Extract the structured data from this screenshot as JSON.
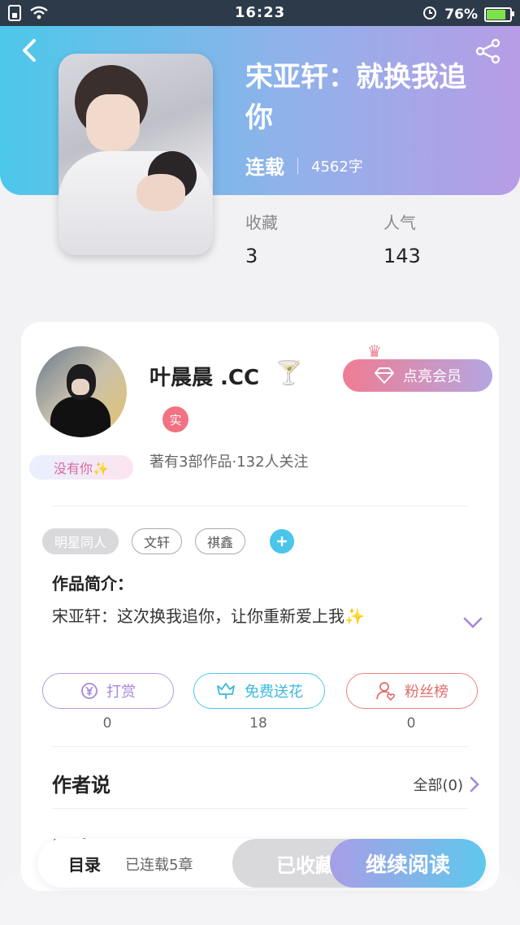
{
  "status_bar": {
    "time": "16:23",
    "battery": "76%",
    "battery_level": 0.76
  },
  "book": {
    "title": "宋亚轩：就换我追你",
    "status": "连载",
    "word_count": "4562字"
  },
  "stats": [
    {
      "label": "收藏",
      "value": "3"
    },
    {
      "label": "人气",
      "value": "143"
    }
  ],
  "author": {
    "name": "叶晨晨 .CC",
    "verify_badge": "实",
    "badge_frame_text": "没有你✨",
    "subtitle": "著有3部作品·132人关注",
    "vip_button": "点亮会员"
  },
  "tags": [
    "明星同人",
    "文轩",
    "祺鑫"
  ],
  "intro": {
    "heading": "作品简介：",
    "text": "宋亚轩：这次换我追你，让你重新爱上我✨"
  },
  "actions": [
    {
      "label": "打赏",
      "count": "0",
      "icon": "yuan-icon"
    },
    {
      "label": "免费送花",
      "count": "18",
      "icon": "flower-icon"
    },
    {
      "label": "粉丝榜",
      "count": "0",
      "icon": "fan-icon"
    }
  ],
  "author_say": {
    "heading": "作者说",
    "all_label": "全部(0)"
  },
  "comments": {
    "heading": "评论"
  },
  "bottom_bar": {
    "directory": "目录",
    "serial_status": "已连载5章",
    "favorited": "已收藏",
    "continue_reading": "继续阅读"
  },
  "colors": {
    "gradient_start": "#4cc8ea",
    "gradient_end": "#b79de6",
    "accent_cyan": "#4bc5ea",
    "accent_red": "#f27183",
    "accent_purple": "#a488da"
  }
}
